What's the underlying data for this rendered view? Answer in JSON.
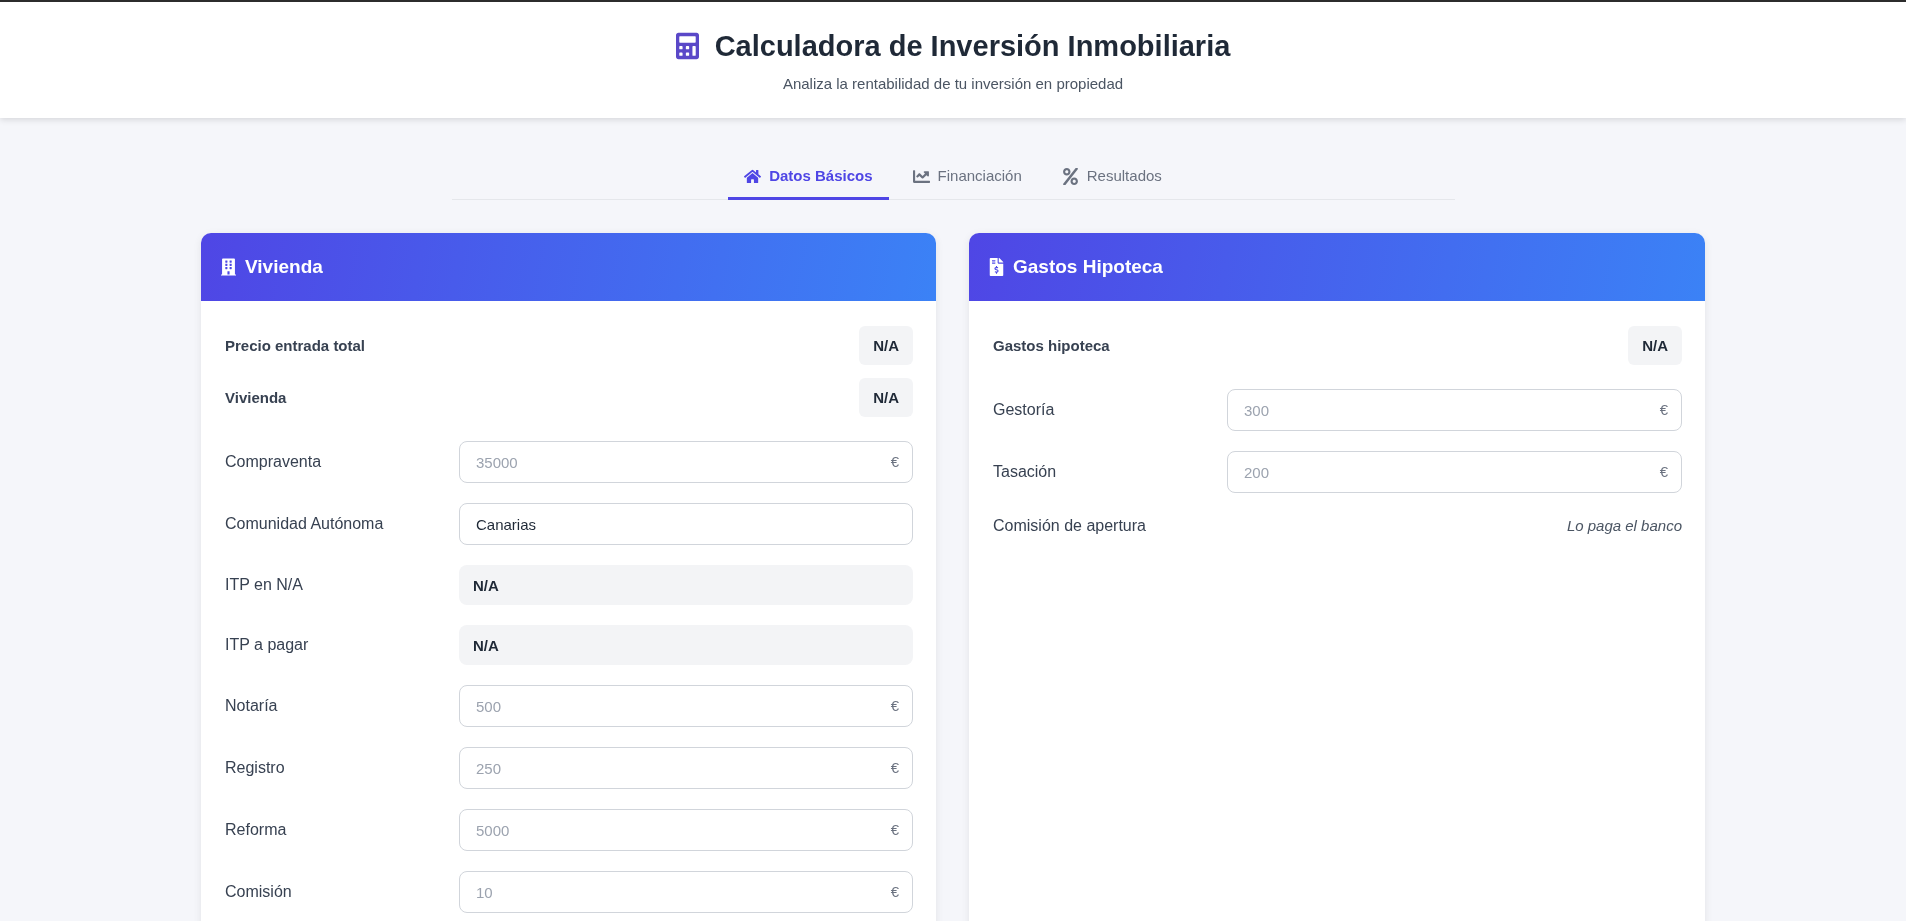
{
  "header": {
    "title": "Calculadora de Inversión Inmobiliaria",
    "subtitle": "Analiza la rentabilidad de tu inversión en propiedad"
  },
  "tabs": [
    {
      "label": "Datos Básicos",
      "selected": true
    },
    {
      "label": "Financiación",
      "selected": false
    },
    {
      "label": "Resultados",
      "selected": false
    }
  ],
  "cards": [
    {
      "title": "Vivienda",
      "rows": [
        {
          "kind": "summary",
          "label": "Precio entrada total",
          "value": "N/A"
        },
        {
          "kind": "summary",
          "label": "Vivienda",
          "value": "N/A"
        },
        {
          "kind": "input",
          "label": "Compraventa",
          "placeholder": "35000",
          "unit": "€"
        },
        {
          "kind": "text",
          "label": "Comunidad Autónoma",
          "value": "Canarias"
        },
        {
          "kind": "readonly",
          "label": "ITP en N/A",
          "value": "N/A"
        },
        {
          "kind": "readonly",
          "label": "ITP a pagar",
          "value": "N/A"
        },
        {
          "kind": "input",
          "label": "Notaría",
          "placeholder": "500",
          "unit": "€"
        },
        {
          "kind": "input",
          "label": "Registro",
          "placeholder": "250",
          "unit": "€"
        },
        {
          "kind": "input",
          "label": "Reforma",
          "placeholder": "5000",
          "unit": "€"
        },
        {
          "kind": "input",
          "label": "Comisión",
          "placeholder": "10",
          "unit": "€"
        }
      ]
    },
    {
      "title": "Gastos Hipoteca",
      "rows": [
        {
          "kind": "summary",
          "label": "Gastos hipoteca",
          "value": "N/A"
        },
        {
          "kind": "input",
          "label": "Gestoría",
          "placeholder": "300",
          "unit": "€"
        },
        {
          "kind": "input",
          "label": "Tasación",
          "placeholder": "200",
          "unit": "€"
        },
        {
          "kind": "note",
          "label": "Comisión de apertura",
          "note": "Lo paga el banco"
        }
      ]
    }
  ]
}
